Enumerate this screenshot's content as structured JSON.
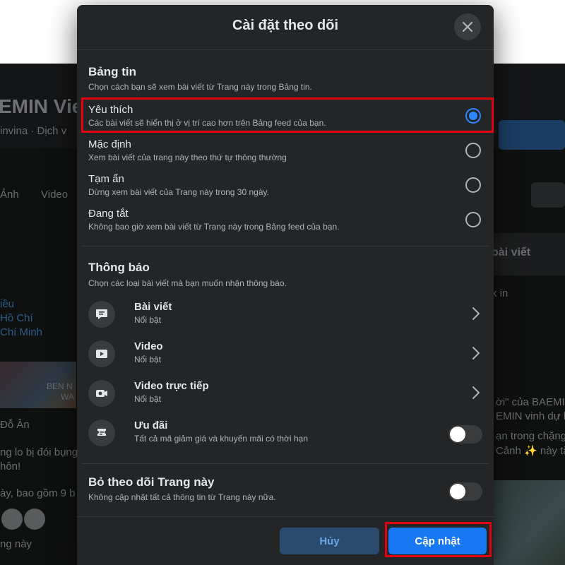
{
  "background": {
    "page_name": "EMIN Vie",
    "page_handle": "invina · Dịch v",
    "tab_photos": "Ảnh",
    "tab_video": "Video",
    "right_posts": "bài viết",
    "right_checkin": "k in",
    "left_lines": [
      "iều",
      "Hồ Chí",
      "Chí Minh"
    ],
    "photo_caption": "BEN N",
    "photo_caption2": "WA",
    "author": "Đỗ Ân",
    "post_line1": "ng lo bị đói bụng!",
    "post_line2": "hôn!",
    "post_line3": "ày, bao gồm 9 b",
    "post_line4": "ng này",
    "right_line1": "ời\" của BAEMI",
    "right_line2": "EMIN vinh dự l",
    "right_line3": "ạn trong chặng",
    "right_line4": "Cảnh ✨ này tặ"
  },
  "dialog": {
    "title": "Cài đặt theo dõi",
    "news_feed": {
      "title": "Bảng tin",
      "subtitle": "Chọn cách bạn sẽ xem bài viết từ Trang này trong Bảng tin.",
      "options": [
        {
          "label": "Yêu thích",
          "desc": "Các bài viết sẽ hiển thị ở vị trí cao hơn trên Bảng feed của bạn.",
          "selected": true
        },
        {
          "label": "Mặc định",
          "desc": "Xem bài viết của trang này theo thứ tự thông thường",
          "selected": false
        },
        {
          "label": "Tạm ẩn",
          "desc": "Dừng xem bài viết của Trang này trong 30 ngày.",
          "selected": false
        },
        {
          "label": "Đang tắt",
          "desc": "Không bao giờ xem bài viết từ Trang này trong Bảng feed của bạn.",
          "selected": false
        }
      ]
    },
    "notifications": {
      "title": "Thông báo",
      "subtitle": "Chọn các loại bài viết mà bạn muốn nhận thông báo.",
      "items": [
        {
          "label": "Bài viết",
          "sub": "Nổi bật",
          "icon": "post-icon"
        },
        {
          "label": "Video",
          "sub": "Nổi bật",
          "icon": "video-play-icon"
        },
        {
          "label": "Video trực tiếp",
          "sub": "Nổi bật",
          "icon": "live-video-icon"
        },
        {
          "label": "Ưu đãi",
          "sub": "Tất cả mã giảm giá và khuyến mãi có thời hạn",
          "icon": "offer-tag-icon",
          "toggle_on": false
        }
      ]
    },
    "unfollow": {
      "title": "Bỏ theo dõi Trang này",
      "subtitle": "Không cập nhật tất cả thông tin từ Trang này nữa.",
      "toggle_on": false
    },
    "cancel_label": "Hủy",
    "update_label": "Cập nhật"
  },
  "colors": {
    "dialog_bg": "#242526",
    "accent": "#1877f2",
    "highlight_box": "#e3000f"
  }
}
